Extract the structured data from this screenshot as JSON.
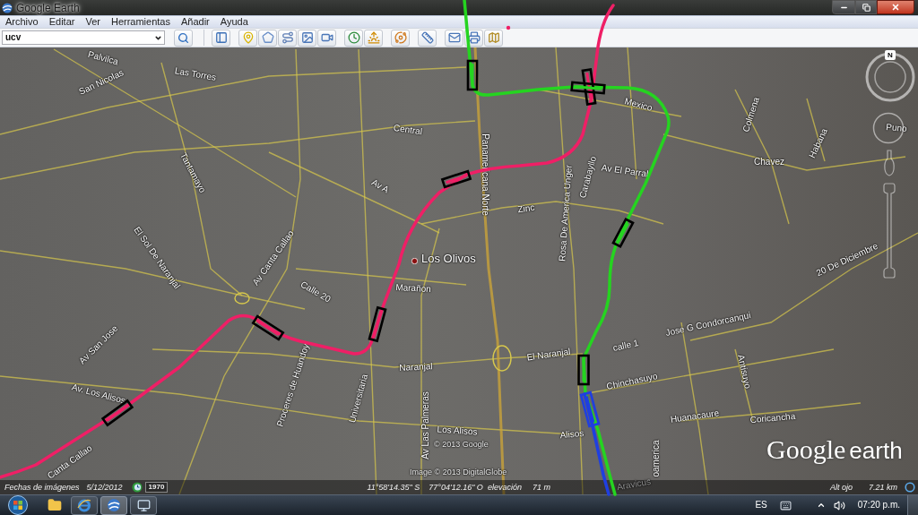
{
  "window": {
    "title": "Google Earth"
  },
  "menu": [
    "Archivo",
    "Editar",
    "Ver",
    "Herramientas",
    "Añadir",
    "Ayuda"
  ],
  "toolbar": {
    "search": {
      "value": "ucv"
    }
  },
  "map": {
    "labels": [
      "Palvilca",
      "Las Torres",
      "San Nicolas",
      "Mexico",
      "Colmena",
      "Puno",
      "Central",
      "Habana",
      "Chavez",
      "Tantamayo",
      "Av El Parral",
      "Carabayllo",
      "Panamericana Norte",
      "Rosa De America Unger",
      "Av A",
      "Zinc",
      "Av Canta Callao",
      "El Sol De Naranjal",
      "20 De Diciembre",
      "Calle 20",
      "Marañon",
      "Jose G Condorcanqui",
      "Av San Jose",
      "calle 1",
      "Proceres de Huandoy",
      "El Naranjal",
      "Naranjal",
      "Antisuyo",
      "Chinchasuyo",
      "Av. Los Alisos",
      "Universitaria",
      "Huanacaure",
      "Coricancha",
      "Av Las Palmeras",
      "Alisos",
      "Los Alisos",
      "oamerica",
      "Canta Callao",
      "Aravicus"
    ],
    "place": {
      "name": "Los Olivos"
    },
    "routes": [
      {
        "color": "#ef1f66"
      },
      {
        "color": "#25d420"
      },
      {
        "color": "#1f3fe0"
      }
    ],
    "compass": "N",
    "attribution": [
      "© 2013 Google",
      "Image © 2013 DigitalGlobe"
    ],
    "logo": {
      "brand": "Google",
      "product": "earth"
    }
  },
  "status_bar": {
    "imagery_label": "Fechas de imágenes",
    "imagery_date": "5/12/2012",
    "year": "1970",
    "latitude": "11°58'14.35\" S",
    "longitude": "77°04'12.16\" O",
    "elevation_label": "elevación",
    "elevation": "71 m",
    "eye_label": "Alt ojo",
    "eye_altitude": "7.21 km"
  },
  "taskbar": {
    "language": "ES",
    "clock": "07:20 p.m."
  }
}
